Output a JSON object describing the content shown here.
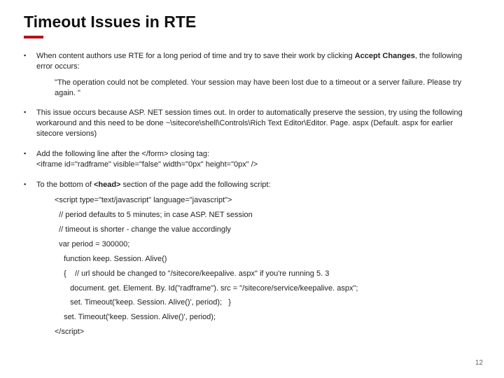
{
  "title": "Timeout Issues in RTE",
  "bullets": {
    "b1_pre": "When content authors use RTE for a long period of time and try to save their work by clicking ",
    "b1_bold": "Accept Changes",
    "b1_post": ", the following error occurs:",
    "quote": "\"The operation could not be completed. Your session may have been          lost due to a timeout or a server failure. Please try again. \"",
    "b2": "This issue occurs because ASP. NET session times out. In order to automatically preserve the session, try using the following workaround and this need to be done ~\\sitecore\\shell\\Controls\\Rich Text Editor\\Editor. Page. aspx (Default. aspx for earlier sitecore versions)",
    "b3_l1": "Add the following line after the </form> closing tag:",
    "b3_l2": "<iframe id=\"radframe\" visible=\"false\" width=\"0px\" height=\"0px\" />",
    "b4_pre": "To the bottom of ",
    "b4_bold": "<head>",
    "b4_post": " section of the page add the following script:"
  },
  "code": {
    "c01": "<script type=\"text/javascript\" language=\"javascript\">",
    "c02": "  // period defaults to 5 minutes; in case ASP. NET session",
    "c03": "  // timeout is shorter - change the value accordingly",
    "c04": "  var period = 300000;",
    "c05": " function keep. Session. Alive()",
    "c06": " {    // url should be changed to \"/sitecore/keepalive. aspx\" if you're running 5. 3",
    "c07": "  document. get. Element. By. Id(\"radframe\"). src = \"/sitecore/service/keepalive. aspx\";",
    "c08": "  set. Timeout('keep. Session. Alive()', period);   }",
    "c09": " set. Timeout('keep. Session. Alive()', period);",
    "c10": "</script>"
  },
  "page_number": "12"
}
